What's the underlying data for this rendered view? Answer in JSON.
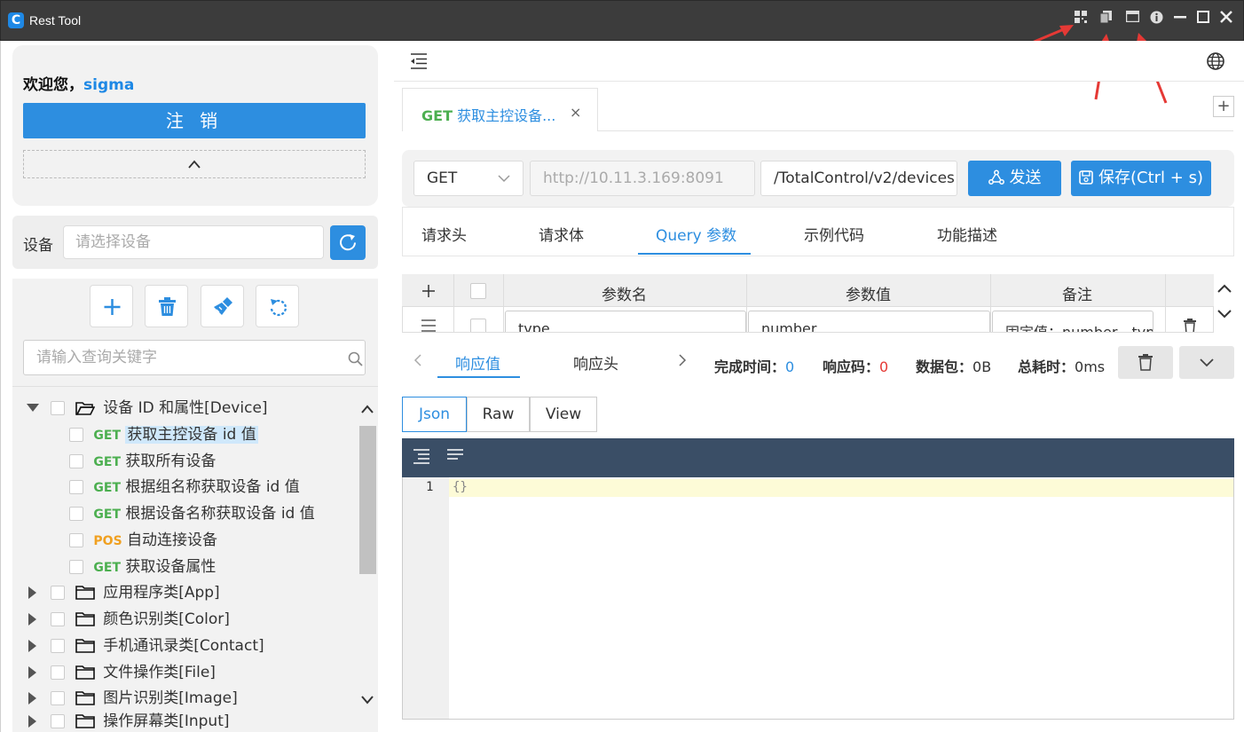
{
  "app": {
    "title": "Rest Tool"
  },
  "user_panel": {
    "welcome_prefix": "欢迎您，",
    "username": "sigma",
    "logout_label": "注 销",
    "collapse_glyph": "^"
  },
  "device": {
    "label": "设备",
    "placeholder": "请选择设备"
  },
  "toolbar": {
    "search_placeholder": "请输入查询关键字"
  },
  "tree": {
    "groups": [
      {
        "label": "设备 ID 和属性[Device]",
        "expanded": true
      },
      {
        "label": "应用程序类[App]"
      },
      {
        "label": "颜色识别类[Color]"
      },
      {
        "label": "手机通讯录类[Contact]"
      },
      {
        "label": "文件操作类[File]"
      },
      {
        "label": "图片识别类[Image]"
      },
      {
        "label": "操作屏幕类[Input]"
      }
    ],
    "items": [
      {
        "method": "GET",
        "label": "获取主控设备 id 值",
        "selected": true
      },
      {
        "method": "GET",
        "label": "获取所有设备"
      },
      {
        "method": "GET",
        "label": "根据组名称获取设备 id 值"
      },
      {
        "method": "GET",
        "label": "根据设备名称获取设备 id 值"
      },
      {
        "method": "POS",
        "label": "自动连接设备"
      },
      {
        "method": "GET",
        "label": "获取设备属性"
      }
    ]
  },
  "request_tab": {
    "method": "GET",
    "title": "获取主控设备...",
    "close": "×",
    "add": "+"
  },
  "request": {
    "method": "GET",
    "host_placeholder": "http://10.11.3.169:8091",
    "path": "/TotalControl/v2/devices",
    "send_label": "发送",
    "save_label": "保存(Ctrl + s)"
  },
  "sub_tabs": [
    "请求头",
    "请求体",
    "Query 参数",
    "示例代码",
    "功能描述"
  ],
  "active_sub_tab": "Query 参数",
  "params": {
    "headers": [
      "参数名",
      "参数值",
      "备注"
    ],
    "rows": [
      {
        "name": "type",
        "value": "number",
        "note": "固定值：number，typ"
      }
    ]
  },
  "response": {
    "tabs": [
      "响应值",
      "响应头"
    ],
    "active_tab": "响应值",
    "stats": [
      {
        "label": "完成时间：",
        "value": "0",
        "color": "#2d8ee0"
      },
      {
        "label": "响应码：",
        "value": "0",
        "color": "#e53935"
      },
      {
        "label": "数据包：",
        "value": "0B",
        "color": "#333333"
      },
      {
        "label": "总耗时：",
        "value": "0ms",
        "color": "#333333"
      }
    ],
    "views": [
      "Json",
      "Raw",
      "View"
    ],
    "active_view": "Json",
    "editor": {
      "line_number": "1",
      "content": "{}"
    }
  },
  "colors": {
    "accent": "#2d8ee0",
    "get": "#4caf50",
    "post": "#f0a020",
    "titlebar": "#3c3c3c",
    "editor_bar": "#3a4e66"
  }
}
